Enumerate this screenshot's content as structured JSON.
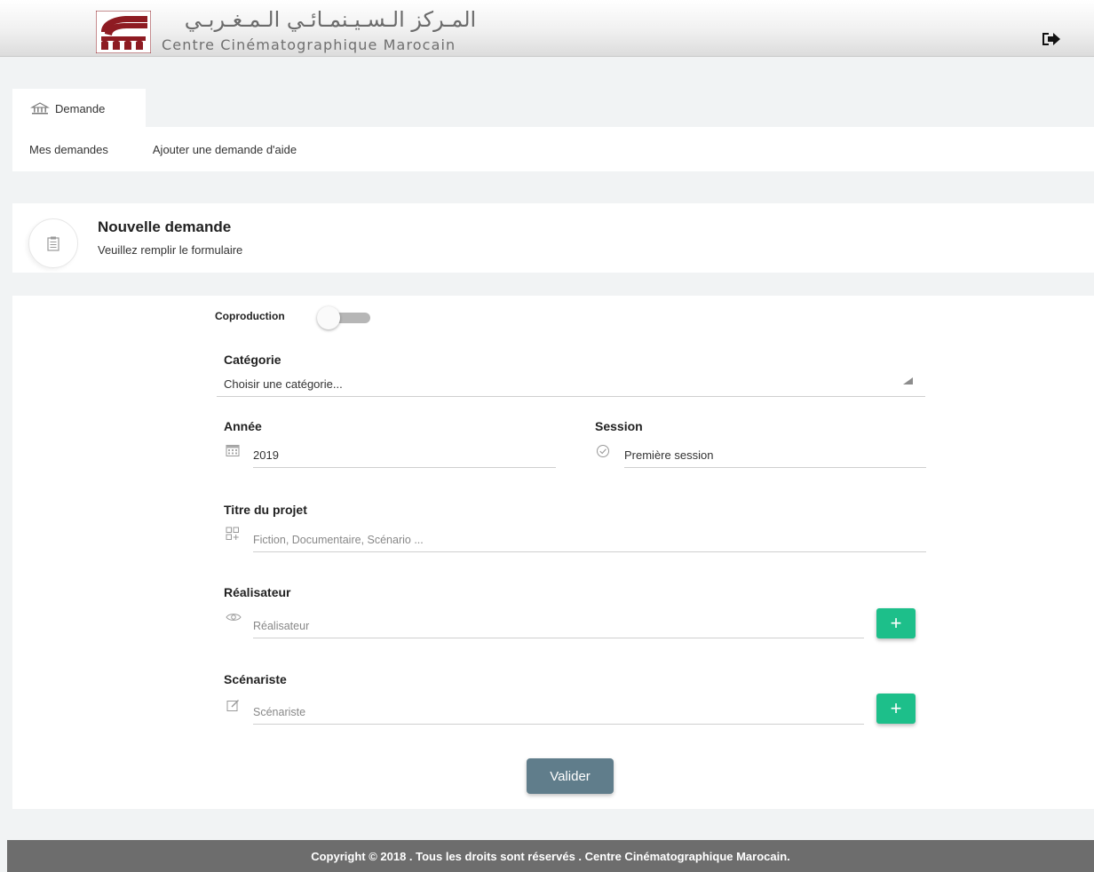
{
  "header": {
    "logo_name_ar": "المـركز الـسـيـنمـائـي الـمـغـربـي",
    "logo_name_fr": "Centre Cinématographique Marocain",
    "logo_icon": "ccm-logo",
    "logout_icon": "sign-out-icon"
  },
  "tabs": [
    {
      "label": "Demande",
      "icon": "bank-icon"
    }
  ],
  "subnav": {
    "mes_demandes": "Mes demandes",
    "ajouter": "Ajouter une demande d'aide"
  },
  "page_header": {
    "title": "Nouvelle demande",
    "subtitle": "Veuillez remplir le formulaire",
    "icon": "clipboard-icon"
  },
  "form": {
    "coproduction_label": "Coproduction",
    "coproduction_on": false,
    "categorie": {
      "label": "Catégorie",
      "value": "Choisir une catégorie..."
    },
    "annee": {
      "label": "Année",
      "value": "2019",
      "icon": "calendar-icon"
    },
    "session": {
      "label": "Session",
      "value": "Première session",
      "icon": "check-circle-icon"
    },
    "titre": {
      "label": "Titre du projet",
      "placeholder": "Fiction, Documentaire, Scénario ...",
      "icon": "grid-add-icon"
    },
    "realisateur": {
      "label": "Réalisateur",
      "placeholder": "Réalisateur",
      "icon": "eye-icon",
      "add": "+"
    },
    "scenariste": {
      "label": "Scénariste",
      "placeholder": "Scénariste",
      "icon": "edit-icon",
      "add": "+"
    },
    "submit": "Valider"
  },
  "footer": {
    "copyright": "Copyright © 2018 . Tous les droits sont réservés . Centre Cinématographique Marocain."
  },
  "colors": {
    "brand": "#8e1b22",
    "add_button": "#1dbf8a",
    "submit_button": "#607d8b",
    "footer_bg": "#6d6d6d"
  }
}
